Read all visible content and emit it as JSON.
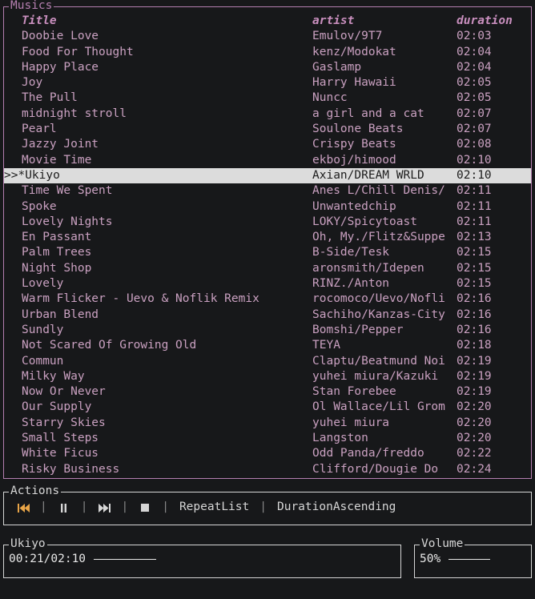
{
  "colors": {
    "background": "#17181a",
    "accent_border": "#b57fb0",
    "text": "#c9a0c0",
    "gray_border": "#d6d6d6",
    "selection_background": "#dcdcdc",
    "selection_text": "#1c1c1c",
    "icon_accent": "#e8a447"
  },
  "musics": {
    "panel_title": "Musics",
    "columns": {
      "title": "Title",
      "artist": "artist",
      "duration": "duration"
    },
    "selected_index": 9,
    "selected_prefix": ">>*",
    "rows": [
      {
        "title": "Doobie Love",
        "artist": "Emulov/9T7",
        "duration": "02:03"
      },
      {
        "title": "Food For Thought",
        "artist": "kenz/Modokat",
        "duration": "02:04"
      },
      {
        "title": "Happy Place",
        "artist": "Gaslamp",
        "duration": "02:04"
      },
      {
        "title": "Joy",
        "artist": "Harry Hawaii",
        "duration": "02:05"
      },
      {
        "title": "The Pull",
        "artist": "Nuncc",
        "duration": "02:05"
      },
      {
        "title": "midnight stroll",
        "artist": "a girl and a cat",
        "duration": "02:07"
      },
      {
        "title": "Pearl",
        "artist": "Soulone Beats",
        "duration": "02:07"
      },
      {
        "title": "Jazzy Joint",
        "artist": "Crispy Beats",
        "duration": "02:08"
      },
      {
        "title": "Movie Time",
        "artist": "ekboj/himood",
        "duration": "02:10"
      },
      {
        "title": ">>*Ukiyo",
        "artist": "Axian/DREAM WRLD",
        "duration": "02:10"
      },
      {
        "title": "Time We Spent",
        "artist": "Anes L/Chill Denis/",
        "duration": "02:11"
      },
      {
        "title": "Spoke",
        "artist": "Unwantedchip",
        "duration": "02:11"
      },
      {
        "title": "Lovely Nights",
        "artist": "LOKY/Spicytoast",
        "duration": "02:11"
      },
      {
        "title": "En Passant",
        "artist": "Oh, My./Flitz&Suppe",
        "duration": "02:13"
      },
      {
        "title": "Palm Trees",
        "artist": "B-Side/Tesk",
        "duration": "02:15"
      },
      {
        "title": "Night Shop",
        "artist": "aronsmith/Idepen",
        "duration": "02:15"
      },
      {
        "title": "Lovely",
        "artist": "RINZ./Anton",
        "duration": "02:15"
      },
      {
        "title": "Warm Flicker - Uevo & Noflik Remix",
        "artist": "rocomoco/Uevo/Nofli",
        "duration": "02:16"
      },
      {
        "title": "Urban Blend",
        "artist": "Sachiho/Kanzas-City",
        "duration": "02:16"
      },
      {
        "title": "Sundly",
        "artist": "Bomshi/Pepper",
        "duration": "02:16"
      },
      {
        "title": "Not Scared Of Growing Old",
        "artist": "TEYA",
        "duration": "02:18"
      },
      {
        "title": "Commun",
        "artist": "Claptu/Beatmund Noi",
        "duration": "02:19"
      },
      {
        "title": "Milky Way",
        "artist": "yuhei miura/Kazuki",
        "duration": "02:19"
      },
      {
        "title": "Now Or Never",
        "artist": "Stan Forebee",
        "duration": "02:19"
      },
      {
        "title": "Our Supply",
        "artist": "Ol Wallace/Lil Grom",
        "duration": "02:20"
      },
      {
        "title": "Starry Skies",
        "artist": "yuhei miura",
        "duration": "02:20"
      },
      {
        "title": "Small Steps",
        "artist": "Langston",
        "duration": "02:20"
      },
      {
        "title": "White Ficus",
        "artist": "Odd Panda/freddo",
        "duration": "02:22"
      },
      {
        "title": "Risky Business",
        "artist": "Clifford/Dougie Do",
        "duration": "02:24"
      }
    ]
  },
  "actions": {
    "panel_title": "Actions",
    "separator": "|",
    "buttons": [
      {
        "name": "previous-track-button",
        "icon": "previous-track-icon",
        "accent": true
      },
      {
        "name": "pause-button",
        "icon": "pause-icon",
        "accent": false
      },
      {
        "name": "next-track-button",
        "icon": "next-track-icon",
        "accent": false
      },
      {
        "name": "stop-button",
        "icon": "stop-icon",
        "accent": false
      }
    ],
    "repeat_mode": "RepeatList",
    "sort_mode": "DurationAscending"
  },
  "progress": {
    "panel_title": "Ukiyo",
    "value": "00:21/02:10"
  },
  "volume": {
    "panel_title": "Volume",
    "value": "50%"
  }
}
